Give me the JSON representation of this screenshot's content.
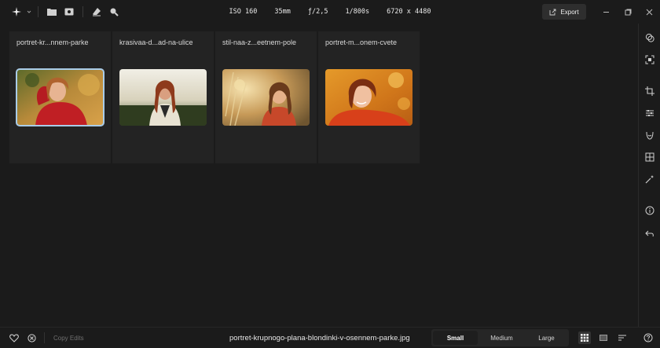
{
  "toolbar": {
    "icons": [
      "sparkle-menu-icon",
      "folder-icon",
      "import-icon",
      "eraser-icon",
      "search-zoom-icon"
    ],
    "export_label": "Export"
  },
  "exif": {
    "iso": "ISO 160",
    "focal": "35mm",
    "aperture": "ƒ/2,5",
    "shutter": "1/800s",
    "dimensions": "6720 x 4480"
  },
  "thumbnails": [
    {
      "title": "portret-kr...nnem-parke",
      "selected": true
    },
    {
      "title": "krasivaa-d...ad-na-ulice",
      "selected": false
    },
    {
      "title": "stil-naa-z...eetnem-pole",
      "selected": false
    },
    {
      "title": "portret-m...onem-cvete",
      "selected": false
    }
  ],
  "bottom": {
    "copy_edits": "Copy Edits",
    "filename": "portret-krupnogo-plana-blondinki-v-osennem-parke.jpg",
    "sizes": [
      "Small",
      "Medium",
      "Large"
    ],
    "active_size": "Small"
  },
  "colors": {
    "background": "#1b1b1b",
    "card": "#232323",
    "selection": "#a9cce8"
  }
}
